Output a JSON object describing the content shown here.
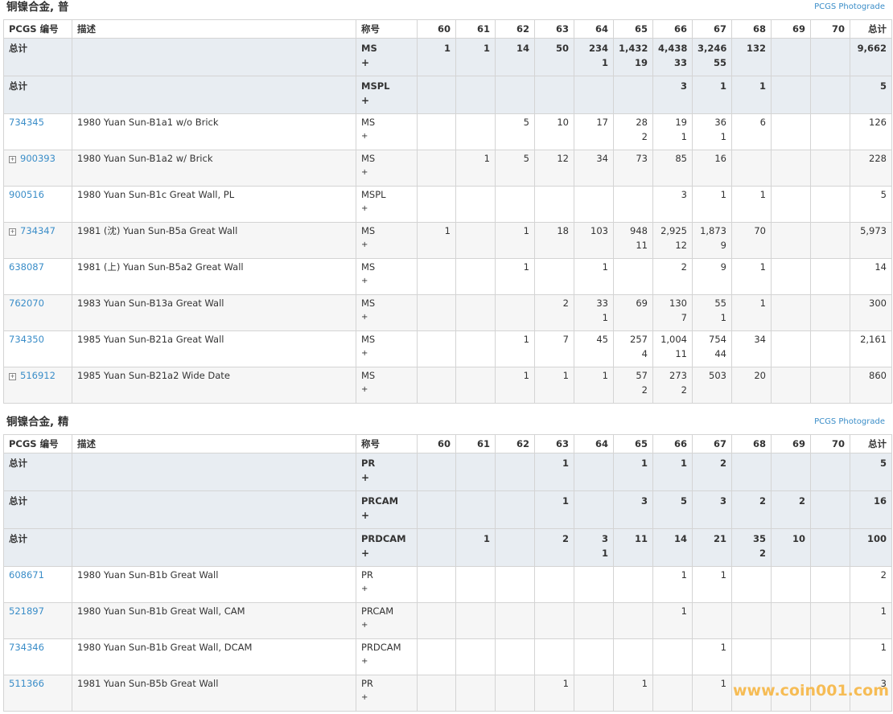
{
  "columns": [
    "PCGS 编号",
    "描述",
    "称号",
    "60",
    "61",
    "62",
    "63",
    "64",
    "65",
    "66",
    "67",
    "68",
    "69",
    "70",
    "总计"
  ],
  "photograde_label": "PCGS Photograde",
  "watermark": "www.coin001.com",
  "sections": [
    {
      "title": "铜镍合金, 普",
      "totals": [
        {
          "label": "总计",
          "designation": "MS",
          "plus": "+",
          "grades": {
            "60": [
              "1",
              ""
            ],
            "61": [
              "1",
              ""
            ],
            "62": [
              "14",
              ""
            ],
            "63": [
              "50",
              ""
            ],
            "64": [
              "234",
              "1"
            ],
            "65": [
              "1,432",
              "19"
            ],
            "66": [
              "4,438",
              "33"
            ],
            "67": [
              "3,246",
              "55"
            ],
            "68": [
              "132",
              ""
            ],
            "69": [
              "",
              ""
            ],
            "70": [
              "",
              ""
            ]
          },
          "total": "9,662"
        },
        {
          "label": "总计",
          "designation": "MSPL",
          "plus": "+",
          "grades": {
            "60": [
              "",
              ""
            ],
            "61": [
              "",
              ""
            ],
            "62": [
              "",
              ""
            ],
            "63": [
              "",
              ""
            ],
            "64": [
              "",
              ""
            ],
            "65": [
              "",
              ""
            ],
            "66": [
              "3",
              ""
            ],
            "67": [
              "1",
              ""
            ],
            "68": [
              "1",
              ""
            ],
            "69": [
              "",
              ""
            ],
            "70": [
              "",
              ""
            ]
          },
          "total": "5"
        }
      ],
      "rows": [
        {
          "id": "734345",
          "expandable": false,
          "desc": "1980 Yuan Sun-B1a1 w/o Brick",
          "designation": "MS",
          "plus": "+",
          "grades": {
            "60": [
              "",
              ""
            ],
            "61": [
              "",
              ""
            ],
            "62": [
              "5",
              ""
            ],
            "63": [
              "10",
              ""
            ],
            "64": [
              "17",
              ""
            ],
            "65": [
              "28",
              "2"
            ],
            "66": [
              "19",
              "1"
            ],
            "67": [
              "36",
              "1"
            ],
            "68": [
              "6",
              ""
            ],
            "69": [
              "",
              ""
            ],
            "70": [
              "",
              ""
            ]
          },
          "total": "126"
        },
        {
          "id": "900393",
          "expandable": true,
          "desc": "1980 Yuan Sun-B1a2 w/ Brick",
          "designation": "MS",
          "plus": "+",
          "grades": {
            "60": [
              "",
              ""
            ],
            "61": [
              "1",
              ""
            ],
            "62": [
              "5",
              ""
            ],
            "63": [
              "12",
              ""
            ],
            "64": [
              "34",
              ""
            ],
            "65": [
              "73",
              ""
            ],
            "66": [
              "85",
              ""
            ],
            "67": [
              "16",
              ""
            ],
            "68": [
              "",
              ""
            ],
            "69": [
              "",
              ""
            ],
            "70": [
              "",
              ""
            ]
          },
          "total": "228"
        },
        {
          "id": "900516",
          "expandable": false,
          "desc": "1980 Yuan Sun-B1c Great Wall, PL",
          "designation": "MSPL",
          "plus": "+",
          "grades": {
            "60": [
              "",
              ""
            ],
            "61": [
              "",
              ""
            ],
            "62": [
              "",
              ""
            ],
            "63": [
              "",
              ""
            ],
            "64": [
              "",
              ""
            ],
            "65": [
              "",
              ""
            ],
            "66": [
              "3",
              ""
            ],
            "67": [
              "1",
              ""
            ],
            "68": [
              "1",
              ""
            ],
            "69": [
              "",
              ""
            ],
            "70": [
              "",
              ""
            ]
          },
          "total": "5"
        },
        {
          "id": "734347",
          "expandable": true,
          "desc": "1981 (沈) Yuan Sun-B5a Great Wall",
          "designation": "MS",
          "plus": "+",
          "grades": {
            "60": [
              "1",
              ""
            ],
            "61": [
              "",
              ""
            ],
            "62": [
              "1",
              ""
            ],
            "63": [
              "18",
              ""
            ],
            "64": [
              "103",
              ""
            ],
            "65": [
              "948",
              "11"
            ],
            "66": [
              "2,925",
              "12"
            ],
            "67": [
              "1,873",
              "9"
            ],
            "68": [
              "70",
              ""
            ],
            "69": [
              "",
              ""
            ],
            "70": [
              "",
              ""
            ]
          },
          "total": "5,973"
        },
        {
          "id": "638087",
          "expandable": false,
          "desc": "1981 (上) Yuan Sun-B5a2 Great Wall",
          "designation": "MS",
          "plus": "+",
          "grades": {
            "60": [
              "",
              ""
            ],
            "61": [
              "",
              ""
            ],
            "62": [
              "1",
              ""
            ],
            "63": [
              "",
              ""
            ],
            "64": [
              "1",
              ""
            ],
            "65": [
              "",
              ""
            ],
            "66": [
              "2",
              ""
            ],
            "67": [
              "9",
              ""
            ],
            "68": [
              "1",
              ""
            ],
            "69": [
              "",
              ""
            ],
            "70": [
              "",
              ""
            ]
          },
          "total": "14"
        },
        {
          "id": "762070",
          "expandable": false,
          "desc": "1983 Yuan Sun-B13a Great Wall",
          "designation": "MS",
          "plus": "+",
          "grades": {
            "60": [
              "",
              ""
            ],
            "61": [
              "",
              ""
            ],
            "62": [
              "",
              ""
            ],
            "63": [
              "2",
              ""
            ],
            "64": [
              "33",
              "1"
            ],
            "65": [
              "69",
              ""
            ],
            "66": [
              "130",
              "7"
            ],
            "67": [
              "55",
              "1"
            ],
            "68": [
              "1",
              ""
            ],
            "69": [
              "",
              ""
            ],
            "70": [
              "",
              ""
            ]
          },
          "total": "300"
        },
        {
          "id": "734350",
          "expandable": false,
          "desc": "1985 Yuan Sun-B21a Great Wall",
          "designation": "MS",
          "plus": "+",
          "grades": {
            "60": [
              "",
              ""
            ],
            "61": [
              "",
              ""
            ],
            "62": [
              "1",
              ""
            ],
            "63": [
              "7",
              ""
            ],
            "64": [
              "45",
              ""
            ],
            "65": [
              "257",
              "4"
            ],
            "66": [
              "1,004",
              "11"
            ],
            "67": [
              "754",
              "44"
            ],
            "68": [
              "34",
              ""
            ],
            "69": [
              "",
              ""
            ],
            "70": [
              "",
              ""
            ]
          },
          "total": "2,161"
        },
        {
          "id": "516912",
          "expandable": true,
          "desc": "1985 Yuan Sun-B21a2 Wide Date",
          "designation": "MS",
          "plus": "+",
          "grades": {
            "60": [
              "",
              ""
            ],
            "61": [
              "",
              ""
            ],
            "62": [
              "1",
              ""
            ],
            "63": [
              "1",
              ""
            ],
            "64": [
              "1",
              ""
            ],
            "65": [
              "57",
              "2"
            ],
            "66": [
              "273",
              "2"
            ],
            "67": [
              "503",
              ""
            ],
            "68": [
              "20",
              ""
            ],
            "69": [
              "",
              ""
            ],
            "70": [
              "",
              ""
            ]
          },
          "total": "860"
        }
      ]
    },
    {
      "title": "铜镍合金, 精",
      "totals": [
        {
          "label": "总计",
          "designation": "PR",
          "plus": "+",
          "grades": {
            "60": [
              "",
              ""
            ],
            "61": [
              "",
              ""
            ],
            "62": [
              "",
              ""
            ],
            "63": [
              "1",
              ""
            ],
            "64": [
              "",
              ""
            ],
            "65": [
              "1",
              ""
            ],
            "66": [
              "1",
              ""
            ],
            "67": [
              "2",
              ""
            ],
            "68": [
              "",
              ""
            ],
            "69": [
              "",
              ""
            ],
            "70": [
              "",
              ""
            ]
          },
          "total": "5"
        },
        {
          "label": "总计",
          "designation": "PRCAM",
          "plus": "+",
          "grades": {
            "60": [
              "",
              ""
            ],
            "61": [
              "",
              ""
            ],
            "62": [
              "",
              ""
            ],
            "63": [
              "1",
              ""
            ],
            "64": [
              "",
              ""
            ],
            "65": [
              "3",
              ""
            ],
            "66": [
              "5",
              ""
            ],
            "67": [
              "3",
              ""
            ],
            "68": [
              "2",
              ""
            ],
            "69": [
              "2",
              ""
            ],
            "70": [
              "",
              ""
            ]
          },
          "total": "16"
        },
        {
          "label": "总计",
          "designation": "PRDCAM",
          "plus": "+",
          "grades": {
            "60": [
              "",
              ""
            ],
            "61": [
              "1",
              ""
            ],
            "62": [
              "",
              ""
            ],
            "63": [
              "2",
              ""
            ],
            "64": [
              "3",
              "1"
            ],
            "65": [
              "11",
              ""
            ],
            "66": [
              "14",
              ""
            ],
            "67": [
              "21",
              ""
            ],
            "68": [
              "35",
              "2"
            ],
            "69": [
              "10",
              ""
            ],
            "70": [
              "",
              ""
            ]
          },
          "total": "100"
        }
      ],
      "rows": [
        {
          "id": "608671",
          "expandable": false,
          "desc": "1980 Yuan Sun-B1b Great Wall",
          "designation": "PR",
          "plus": "+",
          "grades": {
            "60": [
              "",
              ""
            ],
            "61": [
              "",
              ""
            ],
            "62": [
              "",
              ""
            ],
            "63": [
              "",
              ""
            ],
            "64": [
              "",
              ""
            ],
            "65": [
              "",
              ""
            ],
            "66": [
              "1",
              ""
            ],
            "67": [
              "1",
              ""
            ],
            "68": [
              "",
              ""
            ],
            "69": [
              "",
              ""
            ],
            "70": [
              "",
              ""
            ]
          },
          "total": "2"
        },
        {
          "id": "521897",
          "expandable": false,
          "desc": "1980 Yuan Sun-B1b Great Wall, CAM",
          "designation": "PRCAM",
          "plus": "+",
          "grades": {
            "60": [
              "",
              ""
            ],
            "61": [
              "",
              ""
            ],
            "62": [
              "",
              ""
            ],
            "63": [
              "",
              ""
            ],
            "64": [
              "",
              ""
            ],
            "65": [
              "",
              ""
            ],
            "66": [
              "1",
              ""
            ],
            "67": [
              "",
              ""
            ],
            "68": [
              "",
              ""
            ],
            "69": [
              "",
              ""
            ],
            "70": [
              "",
              ""
            ]
          },
          "total": "1"
        },
        {
          "id": "734346",
          "expandable": false,
          "desc": "1980 Yuan Sun-B1b Great Wall, DCAM",
          "designation": "PRDCAM",
          "plus": "+",
          "grades": {
            "60": [
              "",
              ""
            ],
            "61": [
              "",
              ""
            ],
            "62": [
              "",
              ""
            ],
            "63": [
              "",
              ""
            ],
            "64": [
              "",
              ""
            ],
            "65": [
              "",
              ""
            ],
            "66": [
              "",
              ""
            ],
            "67": [
              "1",
              ""
            ],
            "68": [
              "",
              ""
            ],
            "69": [
              "",
              ""
            ],
            "70": [
              "",
              ""
            ]
          },
          "total": "1"
        },
        {
          "id": "511366",
          "expandable": false,
          "desc": "1981 Yuan Sun-B5b Great Wall",
          "designation": "PR",
          "plus": "+",
          "grades": {
            "60": [
              "",
              ""
            ],
            "61": [
              "",
              ""
            ],
            "62": [
              "",
              ""
            ],
            "63": [
              "1",
              ""
            ],
            "64": [
              "",
              ""
            ],
            "65": [
              "1",
              ""
            ],
            "66": [
              "",
              ""
            ],
            "67": [
              "1",
              ""
            ],
            "68": [
              "",
              ""
            ],
            "69": [
              "",
              ""
            ],
            "70": [
              "",
              ""
            ]
          },
          "total": "3"
        }
      ]
    }
  ]
}
